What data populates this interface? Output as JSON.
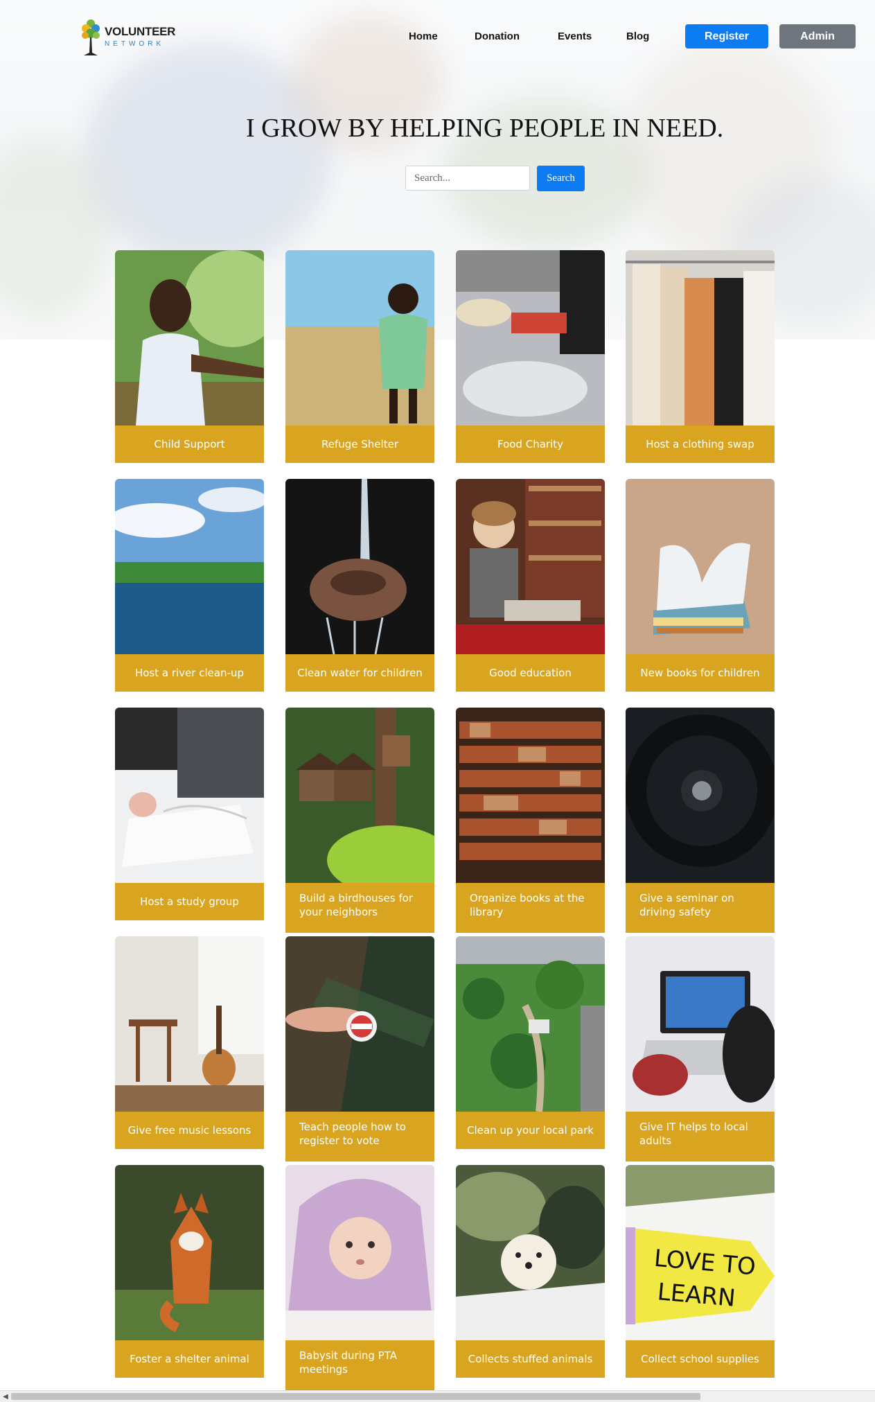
{
  "brand": {
    "line1": "VOLUNTEER",
    "line2": "NETWORK",
    "icon": "tree-logo-icon"
  },
  "nav": {
    "home": "Home",
    "donation": "Donation",
    "events": "Events",
    "blog": "Blog"
  },
  "header_buttons": {
    "register": "Register",
    "admin": "Admin"
  },
  "colors": {
    "primary": "#0d7cf2",
    "secondary": "#6f757c",
    "caption": "#d9a520"
  },
  "hero": {
    "headline": "I GROW BY HELPING PEOPLE IN NEED."
  },
  "search": {
    "placeholder": "Search...",
    "value": "",
    "button": "Search"
  },
  "cards": [
    {
      "title": "Child Support",
      "image": "girl-outdoors-photo"
    },
    {
      "title": "Refuge Shelter",
      "image": "boy-in-field-photo"
    },
    {
      "title": "Food Charity",
      "image": "food-stall-photo"
    },
    {
      "title": "Host a clothing swap",
      "image": "clothing-rack-photo"
    },
    {
      "title": "Host a river clean-up",
      "image": "river-photo"
    },
    {
      "title": "Clean water for children",
      "image": "water-hands-photo"
    },
    {
      "title": "Good education",
      "image": "boy-in-library-photo"
    },
    {
      "title": "New books for children",
      "image": "book-stack-photo"
    },
    {
      "title": "Host a study group",
      "image": "study-notes-photo"
    },
    {
      "title": "Build a birdhouses for your neighbors",
      "image": "birdhouse-photo"
    },
    {
      "title": "Organize books at the library",
      "image": "bookshelves-photo"
    },
    {
      "title": "Give a seminar on driving safety",
      "image": "steering-wheel-photo"
    },
    {
      "title": "Give free music lessons",
      "image": "guitar-room-photo"
    },
    {
      "title": "Teach people how to register to vote",
      "image": "voted-sticker-photo"
    },
    {
      "title": "Clean up your local park",
      "image": "park-aerial-photo"
    },
    {
      "title": "Give IT helps to local adults",
      "image": "laptop-typing-photo"
    },
    {
      "title": "Foster a shelter animal",
      "image": "fox-photo"
    },
    {
      "title": "Babysit during PTA meetings",
      "image": "baby-blanket-photo"
    },
    {
      "title": "Collects stuffed animals",
      "image": "fluffy-dog-photo"
    },
    {
      "title": "Collect school supplies",
      "image": "love-to-learn-sign-photo"
    }
  ]
}
